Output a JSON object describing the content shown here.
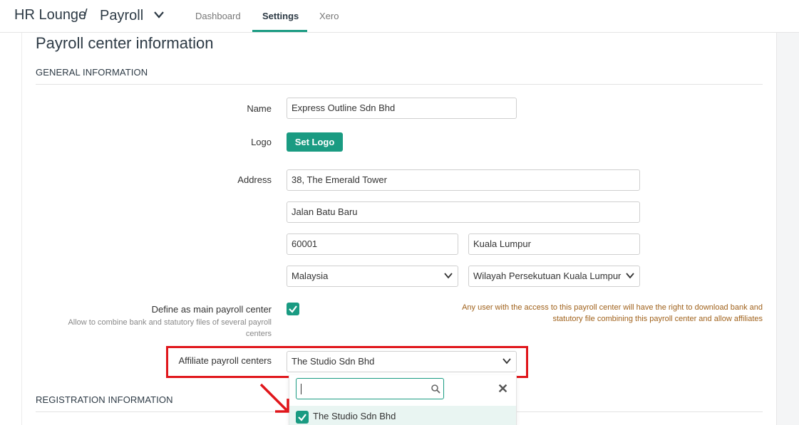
{
  "topbar": {
    "brand": "HR Lounge",
    "separator": "/",
    "module": "Payroll",
    "tabs": [
      {
        "label": "Dashboard",
        "active": false
      },
      {
        "label": "Settings",
        "active": true
      },
      {
        "label": "Xero",
        "active": false
      }
    ]
  },
  "page": {
    "title": "Payroll center information",
    "general_section": "GENERAL INFORMATION",
    "registration_section": "REGISTRATION INFORMATION"
  },
  "form": {
    "name_label": "Name",
    "name_value": "Express Outline Sdn Bhd",
    "logo_label": "Logo",
    "set_logo_button": "Set Logo",
    "address_label": "Address",
    "address_line1": "38, The Emerald Tower",
    "address_line2": "Jalan Batu Baru",
    "postcode": "60001",
    "city": "Kuala Lumpur",
    "country": "Malaysia",
    "state": "Wilayah Persekutuan Kuala Lumpur",
    "main_center_label": "Define as main payroll center",
    "main_center_sublabel": "Allow to combine bank and statutory files of several payroll centers",
    "main_center_checked": true,
    "main_center_note": "Any user with the access to this payroll center will have the right to download bank and statutory file combining this payroll center and allow affiliates",
    "affiliate_label": "Affiliate payroll centers",
    "affiliate_value": "The Studio Sdn Bhd"
  },
  "dropdown": {
    "search_value": "",
    "options": [
      {
        "label": "The Studio Sdn Bhd",
        "checked": true
      }
    ]
  },
  "colors": {
    "accent": "#1a9b82",
    "highlight": "#e0161b",
    "note": "#a0621c"
  },
  "icons": [
    "chevron-down-icon",
    "check-icon",
    "search-icon",
    "close-icon",
    "arrow-icon"
  ]
}
